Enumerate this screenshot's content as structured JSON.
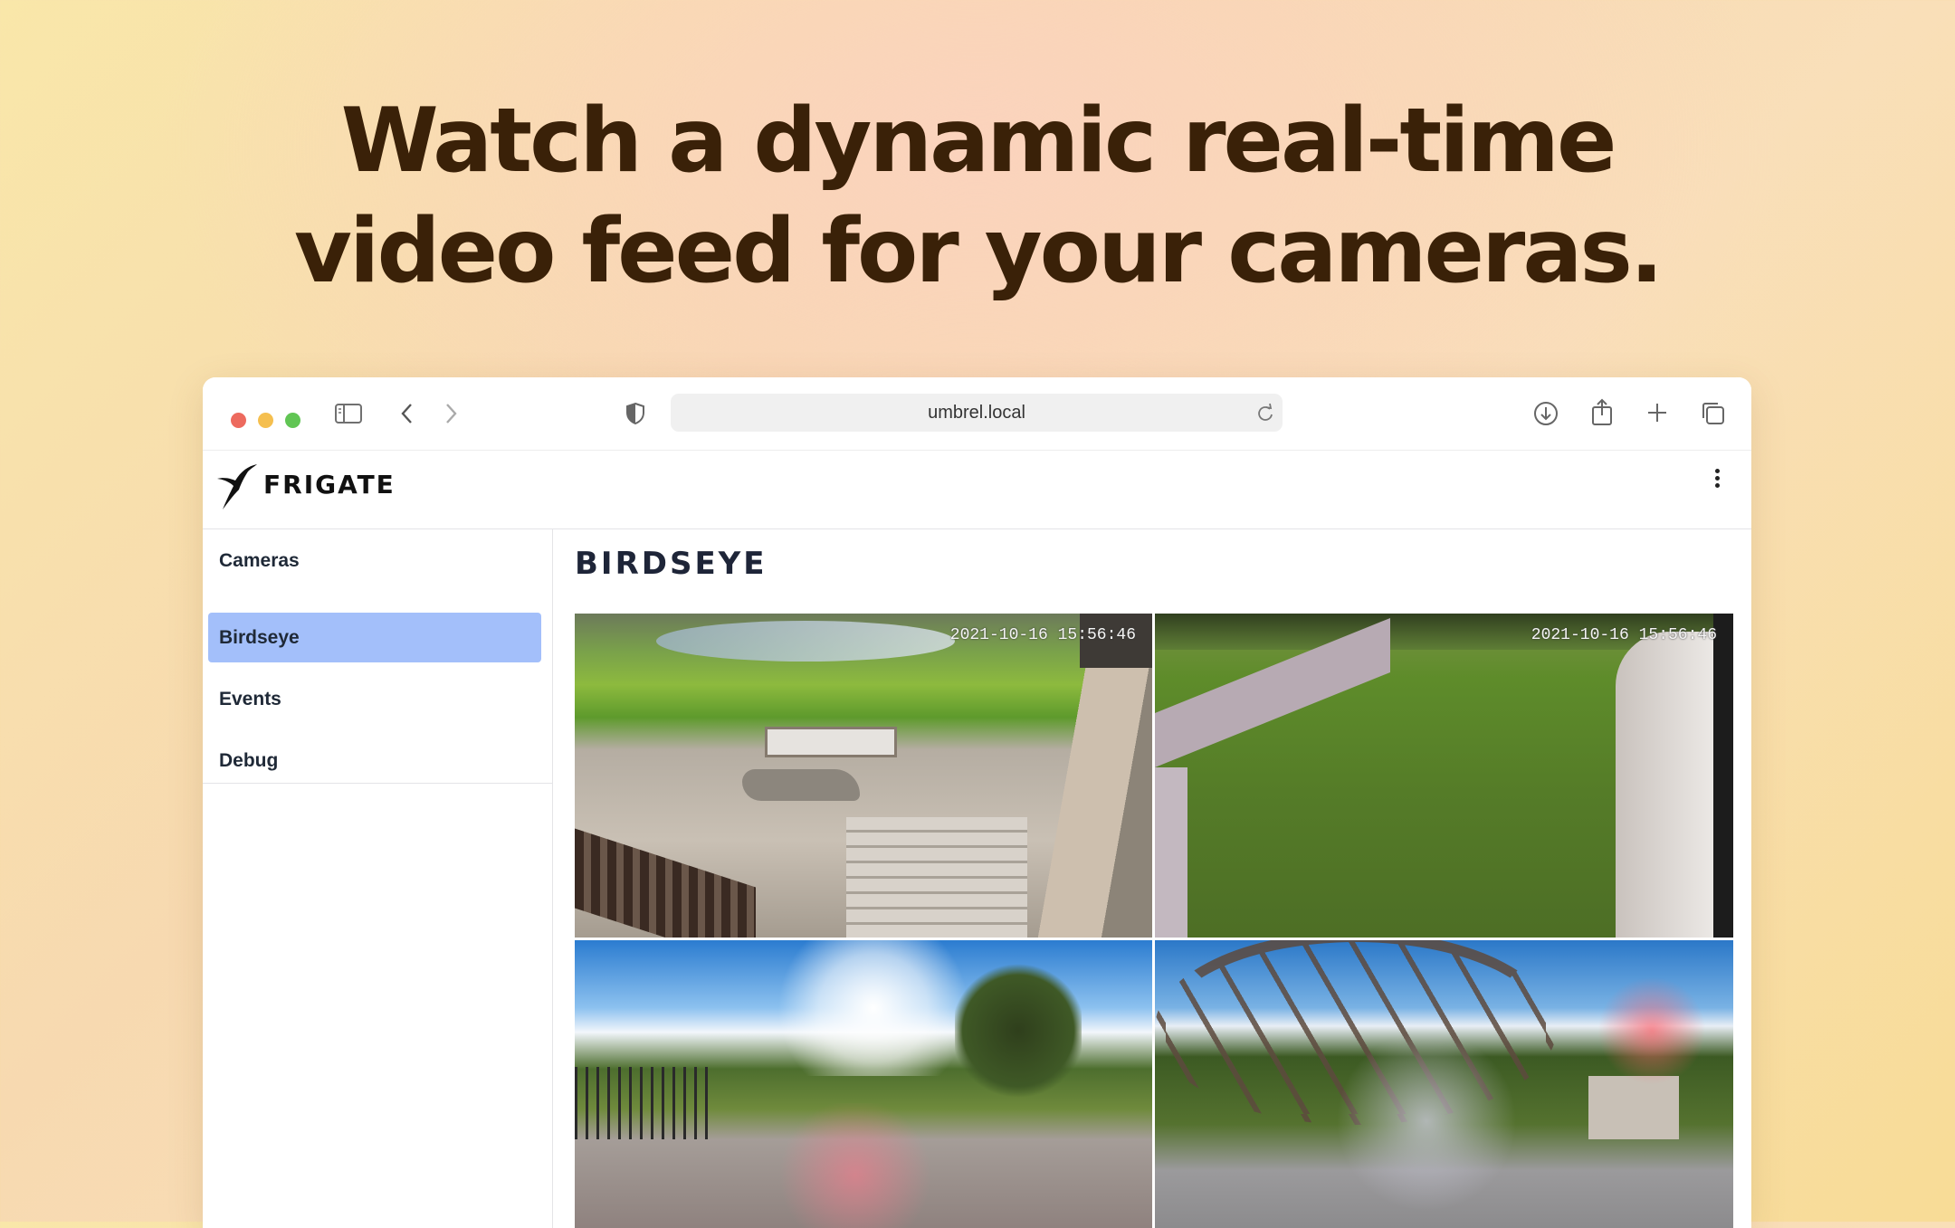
{
  "headline": {
    "line1": "Watch a dynamic real-time",
    "line2": "video feed for your cameras."
  },
  "browser": {
    "url": "umbrel.local",
    "traffic_lights": [
      "#ed6a5e",
      "#f5bf4f",
      "#61c554"
    ],
    "icons": [
      "sidebar-toggle-icon",
      "back-icon",
      "forward-icon",
      "shield-icon",
      "reload-icon",
      "download-icon",
      "share-icon",
      "new-tab-icon",
      "tabs-overview-icon"
    ]
  },
  "app": {
    "brand": "FRIGATE",
    "page_title": "BIRDSEYE",
    "accent": "#a3bffa"
  },
  "sidebar": {
    "items": [
      {
        "label": "Cameras",
        "active": false
      },
      {
        "label": "Birdseye",
        "active": true
      },
      {
        "label": "Events",
        "active": false
      },
      {
        "label": "Debug",
        "active": false
      }
    ]
  },
  "cameras": [
    {
      "timestamp": "2021-10-16 15:56:46"
    },
    {
      "timestamp": "2021-10-16 15:56:46"
    },
    {
      "timestamp": ""
    },
    {
      "timestamp": ""
    }
  ]
}
